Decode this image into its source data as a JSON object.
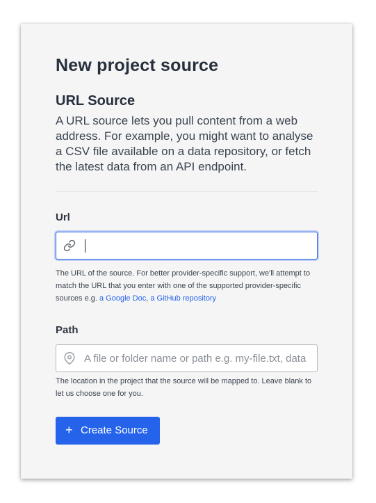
{
  "page": {
    "title": "New project source"
  },
  "section": {
    "title": "URL Source",
    "description": "A URL source lets you pull content from a web address. For example, you might want to analyse a CSV file available on a data repository, or fetch the latest data from an API endpoint."
  },
  "url_field": {
    "label": "Url",
    "value": "",
    "placeholder": "",
    "icon": "link-icon",
    "help_text": "The URL of the source. For better provider-specific support, we'll attempt to match the URL that you enter with one of the supported provider-specific sources e.g.",
    "help_links": [
      "a Google Doc",
      "a GitHub repository"
    ],
    "help_separator": ", "
  },
  "path_field": {
    "label": "Path",
    "value": "",
    "placeholder": "A file or folder name or path e.g. my-file.txt, data",
    "icon": "map-pin-icon",
    "help_text": "The location in the project that the source will be mapped to. Leave blank to let us choose one for you."
  },
  "create_button": {
    "icon": "plus-icon",
    "icon_glyph": "+",
    "label": "Create Source"
  },
  "colors": {
    "accent": "#2563eb",
    "card_background": "#f5f5f5",
    "heading": "#26303d",
    "body_text": "#3b4450"
  }
}
